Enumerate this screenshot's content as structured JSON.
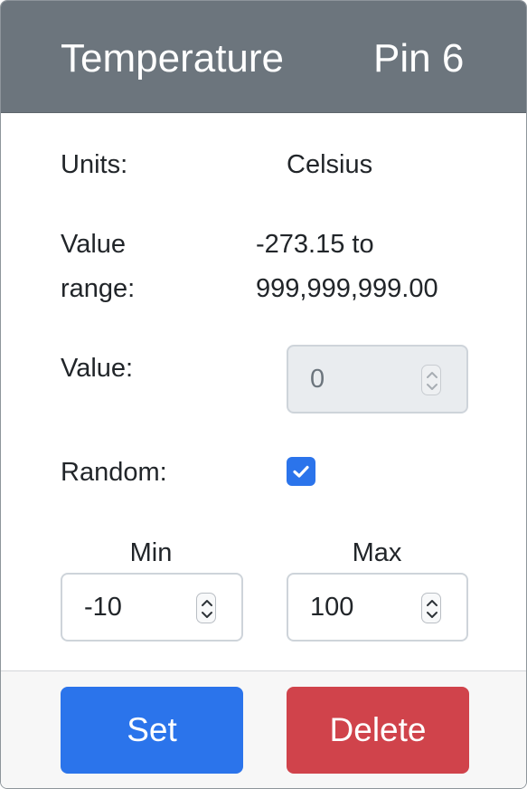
{
  "header": {
    "title": "Temperature",
    "pin": "Pin 6"
  },
  "units": {
    "label": "Units:",
    "value": "Celsius"
  },
  "range": {
    "label_line1": "Value",
    "label_line2": "range:",
    "value_line1": "-273.15 to",
    "value_line2": "999,999,999.00"
  },
  "value_field": {
    "label": "Value:",
    "value": "0",
    "disabled": true
  },
  "random": {
    "label": "Random:",
    "checked": true
  },
  "min": {
    "label": "Min",
    "value": "-10"
  },
  "max": {
    "label": "Max",
    "value": "100"
  },
  "buttons": {
    "set": "Set",
    "delete": "Delete"
  },
  "colors": {
    "header": "#6c757d",
    "primary": "#2b74eb",
    "danger": "#d0434b"
  }
}
